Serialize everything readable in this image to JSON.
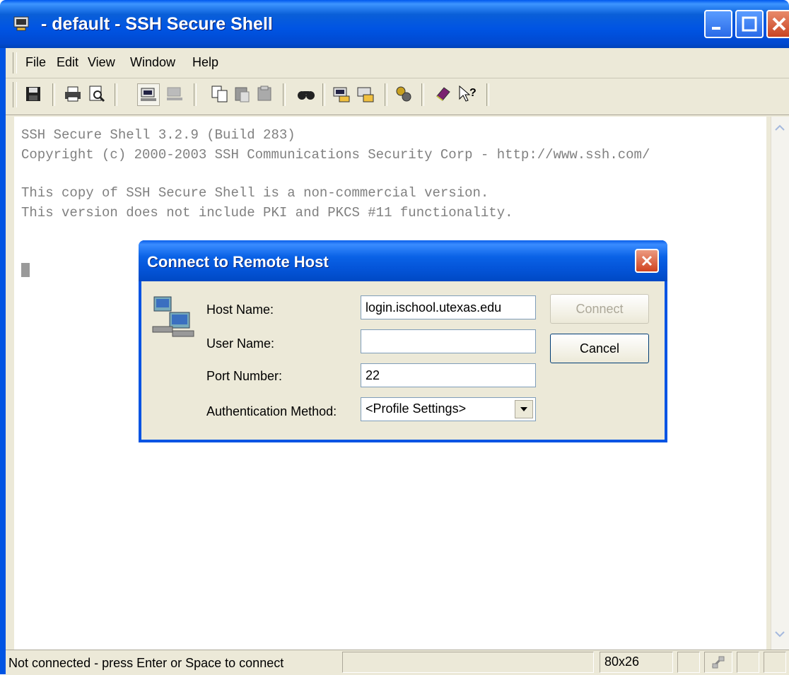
{
  "window": {
    "title": " - default - SSH Secure Shell"
  },
  "menu": [
    "File",
    "Edit",
    "View",
    "Window",
    "Help"
  ],
  "toolbar_icons": [
    "save-icon",
    "print-icon",
    "print-preview-icon",
    "quick-connect-icon",
    "disconnect-icon",
    "copy-icon",
    "paste-icon",
    "paste-alt-icon",
    "find-icon",
    "profile-icon",
    "profile-edit-icon",
    "settings-icon",
    "help-book-icon",
    "context-help-icon"
  ],
  "terminal": {
    "lines": [
      "SSH Secure Shell 3.2.9 (Build 283)",
      "Copyright (c) 2000-2003 SSH Communications Security Corp - http://www.ssh.com/",
      "This copy of SSH Secure Shell is a non-commercial version.",
      "This version does not include PKI and PKCS #11 functionality."
    ]
  },
  "dialog": {
    "title": "Connect to Remote Host",
    "host_label": "Host Name:",
    "host_value": "login.ischool.utexas.edu",
    "user_label": "User Name:",
    "user_value": "",
    "port_label": "Port Number:",
    "port_value": "22",
    "auth_label": "Authentication Method:",
    "auth_value": "<Profile Settings>",
    "connect_label": "Connect",
    "cancel_label": "Cancel"
  },
  "status": {
    "message": "Not connected - press Enter or Space to connect",
    "size": "80x26"
  },
  "colors": {
    "titlebar": "#0054e3",
    "chrome": "#ece9d8",
    "terminal_text": "#808080"
  }
}
